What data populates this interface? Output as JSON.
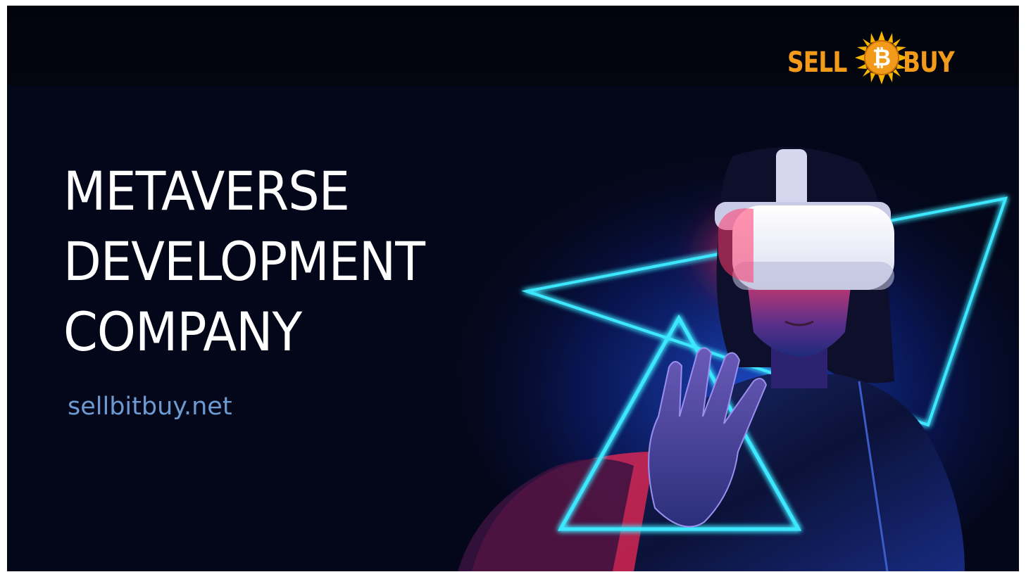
{
  "banner": {
    "title_lines": [
      "METAVERSE",
      "DEVELOPMENT",
      "COMPANY"
    ],
    "website": "sellbitbuy.net"
  },
  "logo": {
    "left_word": "SELL",
    "right_word": "BUY",
    "coin_icon": "bitcoin-sun-icon"
  },
  "photo": {
    "subject": "vr-headset-woman-photo",
    "shape_icon": "neon-triangles-icon"
  },
  "colors": {
    "background": "#040719",
    "title": "#ffffff",
    "website": "#6e9ad2",
    "logo_text": "#f29a1a",
    "neon_cyan": "#3ee8ff",
    "accent_red": "#ff2a55"
  }
}
